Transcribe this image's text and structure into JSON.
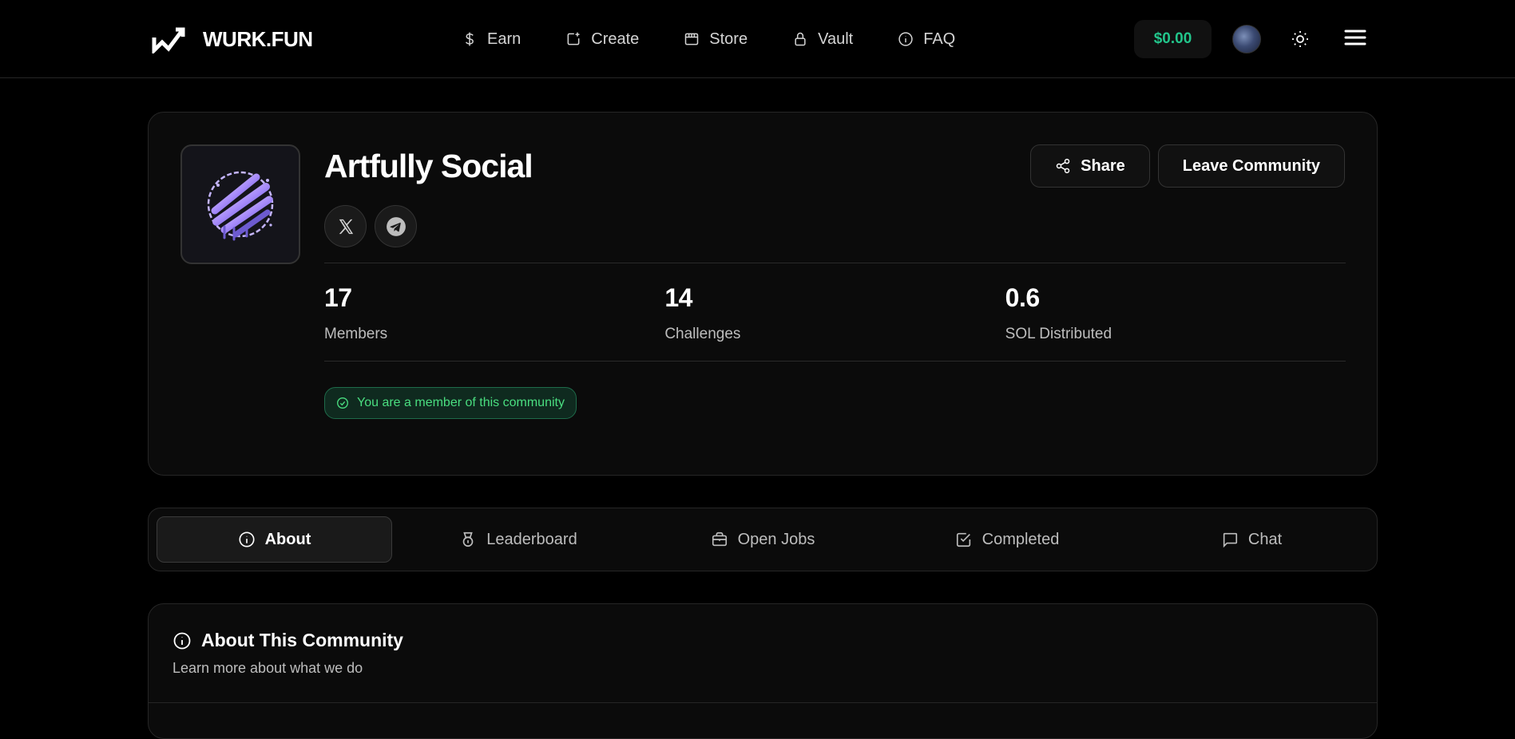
{
  "header": {
    "brand": "WURK.FUN",
    "nav": [
      {
        "label": "Earn",
        "icon": "dollar-icon"
      },
      {
        "label": "Create",
        "icon": "create-icon"
      },
      {
        "label": "Store",
        "icon": "store-icon"
      },
      {
        "label": "Vault",
        "icon": "lock-icon"
      },
      {
        "label": "FAQ",
        "icon": "info-icon"
      }
    ],
    "balance": "$0.00",
    "accent_color": "#22c58b"
  },
  "community": {
    "name": "Artfully Social",
    "share_label": "Share",
    "leave_label": "Leave Community",
    "stats": [
      {
        "value": "17",
        "label": "Members"
      },
      {
        "value": "14",
        "label": "Challenges"
      },
      {
        "value": "0.6",
        "label": "SOL Distributed"
      }
    ],
    "member_badge": "You are a member of this community"
  },
  "tabs": [
    {
      "label": "About",
      "icon": "info-icon",
      "active": true
    },
    {
      "label": "Leaderboard",
      "icon": "medal-icon",
      "active": false
    },
    {
      "label": "Open Jobs",
      "icon": "briefcase-icon",
      "active": false
    },
    {
      "label": "Completed",
      "icon": "check-square-icon",
      "active": false
    },
    {
      "label": "Chat",
      "icon": "chat-icon",
      "active": false
    }
  ],
  "about": {
    "title": "About This Community",
    "subtitle": "Learn more about what we do"
  }
}
